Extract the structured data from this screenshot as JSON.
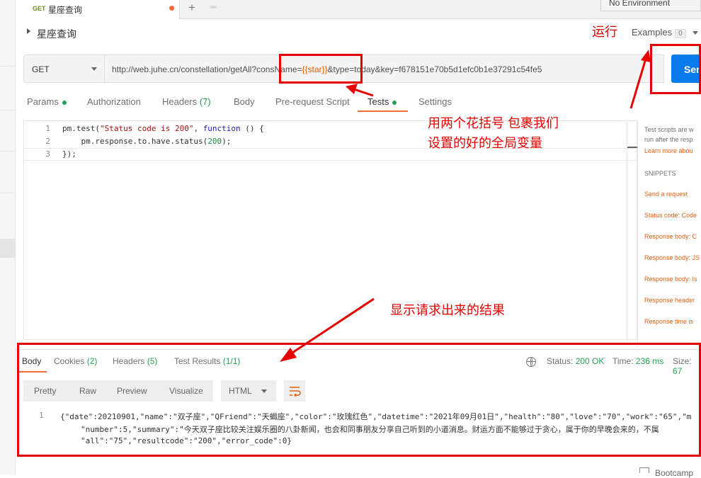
{
  "tabbar": {
    "method": "GET",
    "tab_title": "星座查询",
    "new_tab_symbol": "+",
    "more_symbol": "○○○",
    "environment": "No Environment"
  },
  "request": {
    "title": "星座查询",
    "examples_label": "Examples",
    "examples_count": "0",
    "method": "GET",
    "url_before": "http://web.juhe.cn/constellation/getAll?consName=",
    "url_var": "{{star}}",
    "url_after": "&type=today&key=f678151e70b5d1efc0b1e37291c54fe5",
    "send_label": "Send"
  },
  "request_tabs": {
    "params": "Params",
    "authorization": "Authorization",
    "headers": "Headers",
    "headers_count": "(7)",
    "body": "Body",
    "prerequest": "Pre-request Script",
    "tests": "Tests",
    "settings": "Settings"
  },
  "editor": {
    "line_numbers": [
      "1",
      "2",
      "3"
    ]
  },
  "snippets": {
    "intro_1": "Test scripts are w",
    "intro_2": "run after the resp",
    "learn_more": "Learn more abou",
    "header": "SNIPPETS",
    "items": [
      "Send a request",
      "Status code: Code",
      "Response body: C",
      "Response body: JS",
      "Response body: Is",
      "Response header",
      "Response time is"
    ]
  },
  "response": {
    "tabs": {
      "body": "Body",
      "cookies": "Cookies",
      "cookies_count": "(2)",
      "headers": "Headers",
      "headers_count": "(5)",
      "test_results": "Test Results",
      "test_results_count": "(1/1)"
    },
    "status_label": "Status:",
    "status_value": "200 OK",
    "time_label": "Time:",
    "time_value": "236 ms",
    "size_label": "Size:",
    "size_value": "67",
    "view_modes": [
      "Pretty",
      "Raw",
      "Preview",
      "Visualize"
    ],
    "format": "HTML",
    "line_number": "1",
    "lines": [
      "{\"date\":20210901,\"name\":\"双子座\",\"QFriend\":\"天蝎座\",\"color\":\"玫瑰红色\",\"datetime\":\"2021年09月01日\",\"health\":\"80\",\"love\":\"70\",\"work\":\"65\",\"m",
      "\"number\":5,\"summary\":\"今天双子座比较关注娱乐圈的八卦新闻，也会和同事朋友分享自己听到的小道消息。财运方面不能够过于贪心，属于你的早晚会来的，不属",
      "\"all\":\"75\",\"resultcode\":\"200\",\"error_code\":0}"
    ]
  },
  "annotations": {
    "run": "运行",
    "braces_line1": "用两个花括号 包裹我们",
    "braces_line2": "设置的好的全局变量",
    "result": "显示请求出来的结果"
  },
  "bottom": {
    "bootcamp": "Bootcamp"
  },
  "colors": {
    "accent": "#f26b3a",
    "send": "#097bed",
    "success": "#26a052",
    "annotation": "#e60000"
  }
}
